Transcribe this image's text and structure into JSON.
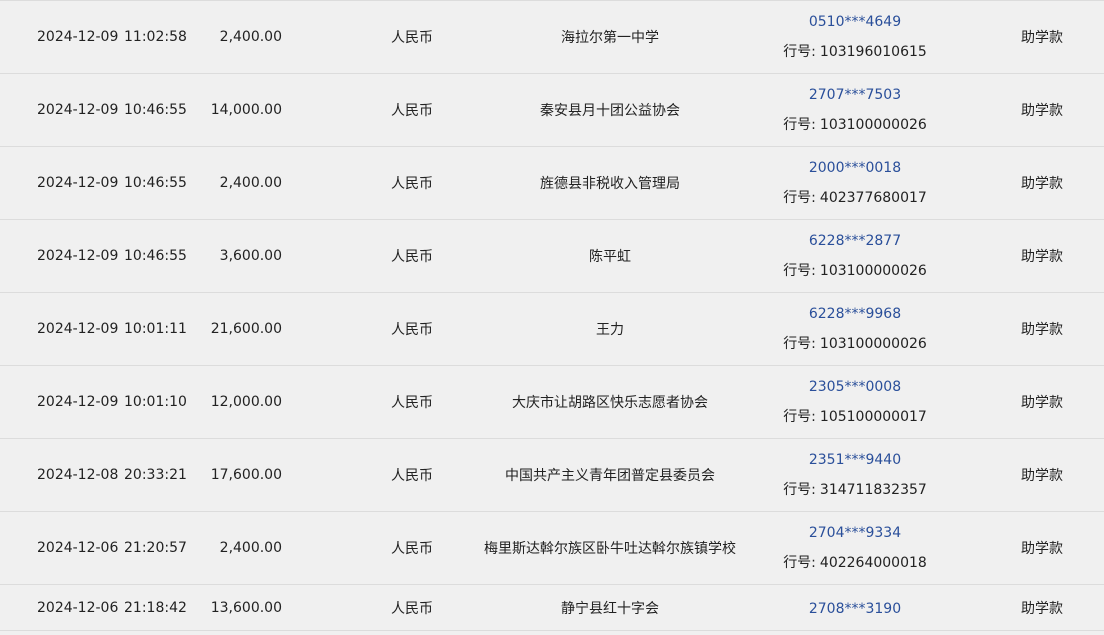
{
  "table": {
    "bank_label": "行号:",
    "rows": [
      {
        "date": "2024-12-09",
        "time": "11:02:58",
        "amount": "2,400.00",
        "currency": "人民币",
        "payee": "海拉尔第一中学",
        "account": "0510***4649",
        "bank_code": "103196010615",
        "purpose": "助学款"
      },
      {
        "date": "2024-12-09",
        "time": "10:46:55",
        "amount": "14,000.00",
        "currency": "人民币",
        "payee": "秦安县月十团公益协会",
        "account": "2707***7503",
        "bank_code": "103100000026",
        "purpose": "助学款"
      },
      {
        "date": "2024-12-09",
        "time": "10:46:55",
        "amount": "2,400.00",
        "currency": "人民币",
        "payee": "旌德县非税收入管理局",
        "account": "2000***0018",
        "bank_code": "402377680017",
        "purpose": "助学款"
      },
      {
        "date": "2024-12-09",
        "time": "10:46:55",
        "amount": "3,600.00",
        "currency": "人民币",
        "payee": "陈平虹",
        "account": "6228***2877",
        "bank_code": "103100000026",
        "purpose": "助学款"
      },
      {
        "date": "2024-12-09",
        "time": "10:01:11",
        "amount": "21,600.00",
        "currency": "人民币",
        "payee": "王力",
        "account": "6228***9968",
        "bank_code": "103100000026",
        "purpose": "助学款"
      },
      {
        "date": "2024-12-09",
        "time": "10:01:10",
        "amount": "12,000.00",
        "currency": "人民币",
        "payee": "大庆市让胡路区快乐志愿者协会",
        "account": "2305***0008",
        "bank_code": "105100000017",
        "purpose": "助学款"
      },
      {
        "date": "2024-12-08",
        "time": "20:33:21",
        "amount": "17,600.00",
        "currency": "人民币",
        "payee": "中国共产主义青年团普定县委员会",
        "account": "2351***9440",
        "bank_code": "314711832357",
        "purpose": "助学款"
      },
      {
        "date": "2024-12-06",
        "time": "21:20:57",
        "amount": "2,400.00",
        "currency": "人民币",
        "payee": "梅里斯达斡尔族区卧牛吐达斡尔族镇学校",
        "account": "2704***9334",
        "bank_code": "402264000018",
        "purpose": "助学款"
      },
      {
        "date": "2024-12-06",
        "time": "21:18:42",
        "amount": "13,600.00",
        "currency": "人民币",
        "payee": "静宁县红十字会",
        "account": "2708***3190",
        "purpose": "助学款"
      }
    ]
  }
}
